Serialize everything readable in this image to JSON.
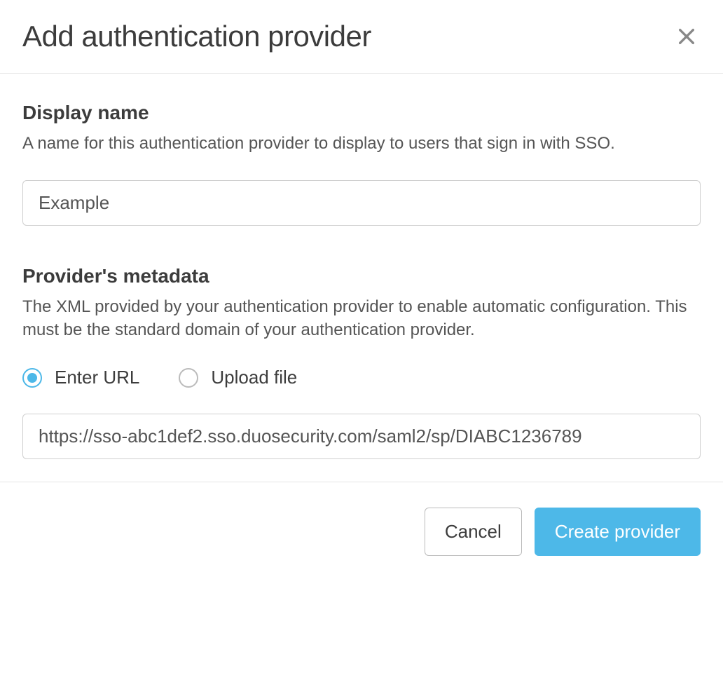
{
  "modal": {
    "title": "Add authentication provider"
  },
  "displayName": {
    "title": "Display name",
    "desc": "A name for this authentication provider to display to users that sign in with SSO.",
    "value": "Example"
  },
  "metadata": {
    "title": "Provider's metadata",
    "desc": "The XML provided by your authentication provider to enable automatic configuration. This must be the standard domain of your authentication provider.",
    "radio": {
      "enterUrl": "Enter URL",
      "uploadFile": "Upload file"
    },
    "urlValue": "https://sso-abc1def2.sso.duosecurity.com/saml2/sp/DIABC1236789"
  },
  "footer": {
    "cancel": "Cancel",
    "create": "Create provider"
  }
}
